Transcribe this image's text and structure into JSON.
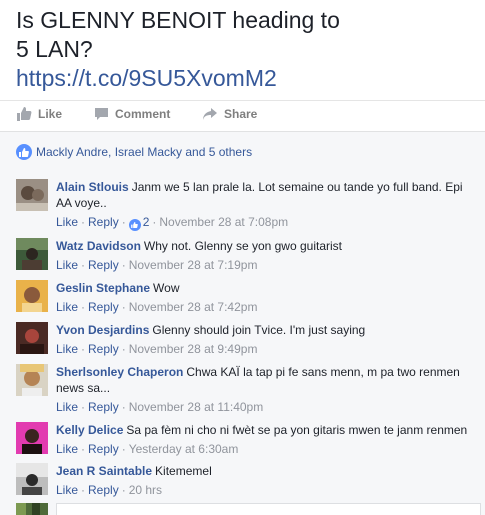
{
  "post": {
    "line1": "Is GLENNY BENOIT heading to",
    "line2": "5 LAN?",
    "link": "https://t.co/9SU5XvomM2"
  },
  "actions": {
    "like": "Like",
    "comment": "Comment",
    "share": "Share"
  },
  "reactions": {
    "text": "Mackly Andre, Israel Macky and 5 others"
  },
  "comments": [
    {
      "author": "Alain Stlouis",
      "text": "Janm we 5 lan prale la. Lot semaine ou tande yo full band. Epi AA voye..",
      "like": "Like",
      "reply": "Reply",
      "likes": "2",
      "time": "November 28 at 7:08pm"
    },
    {
      "author": "Watz Davidson",
      "text": "Why not. Glenny se yon gwo guitarist",
      "like": "Like",
      "reply": "Reply",
      "time": "November 28 at 7:19pm"
    },
    {
      "author": "Geslin Stephane",
      "text": "Wow",
      "like": "Like",
      "reply": "Reply",
      "time": "November 28 at 7:42pm"
    },
    {
      "author": "Yvon Desjardins",
      "text": "Glenny should join Tvice. I'm just saying",
      "like": "Like",
      "reply": "Reply",
      "time": "November 28 at 9:49pm"
    },
    {
      "author": "Sherlsonley Chaperon",
      "text": "Chwa KAÏ la tap pi fe sans menn, m pa two renmen news sa...",
      "like": "Like",
      "reply": "Reply",
      "time": "November 28 at 11:40pm"
    },
    {
      "author": "Kelly Delice",
      "text": "Sa pa fèm ni cho ni fwèt se pa yon gitaris mwen te janm renmen",
      "like": "Like",
      "reply": "Reply",
      "time": "Yesterday at 6:30am"
    },
    {
      "author": "Jean R Saintable",
      "text": "Kitememel",
      "like": "Like",
      "reply": "Reply",
      "time": "20 hrs"
    }
  ],
  "colors": {
    "link": "#365899",
    "meta": "#90949c",
    "like_blue": "#5890ff",
    "panel": "#f6f7f9"
  }
}
